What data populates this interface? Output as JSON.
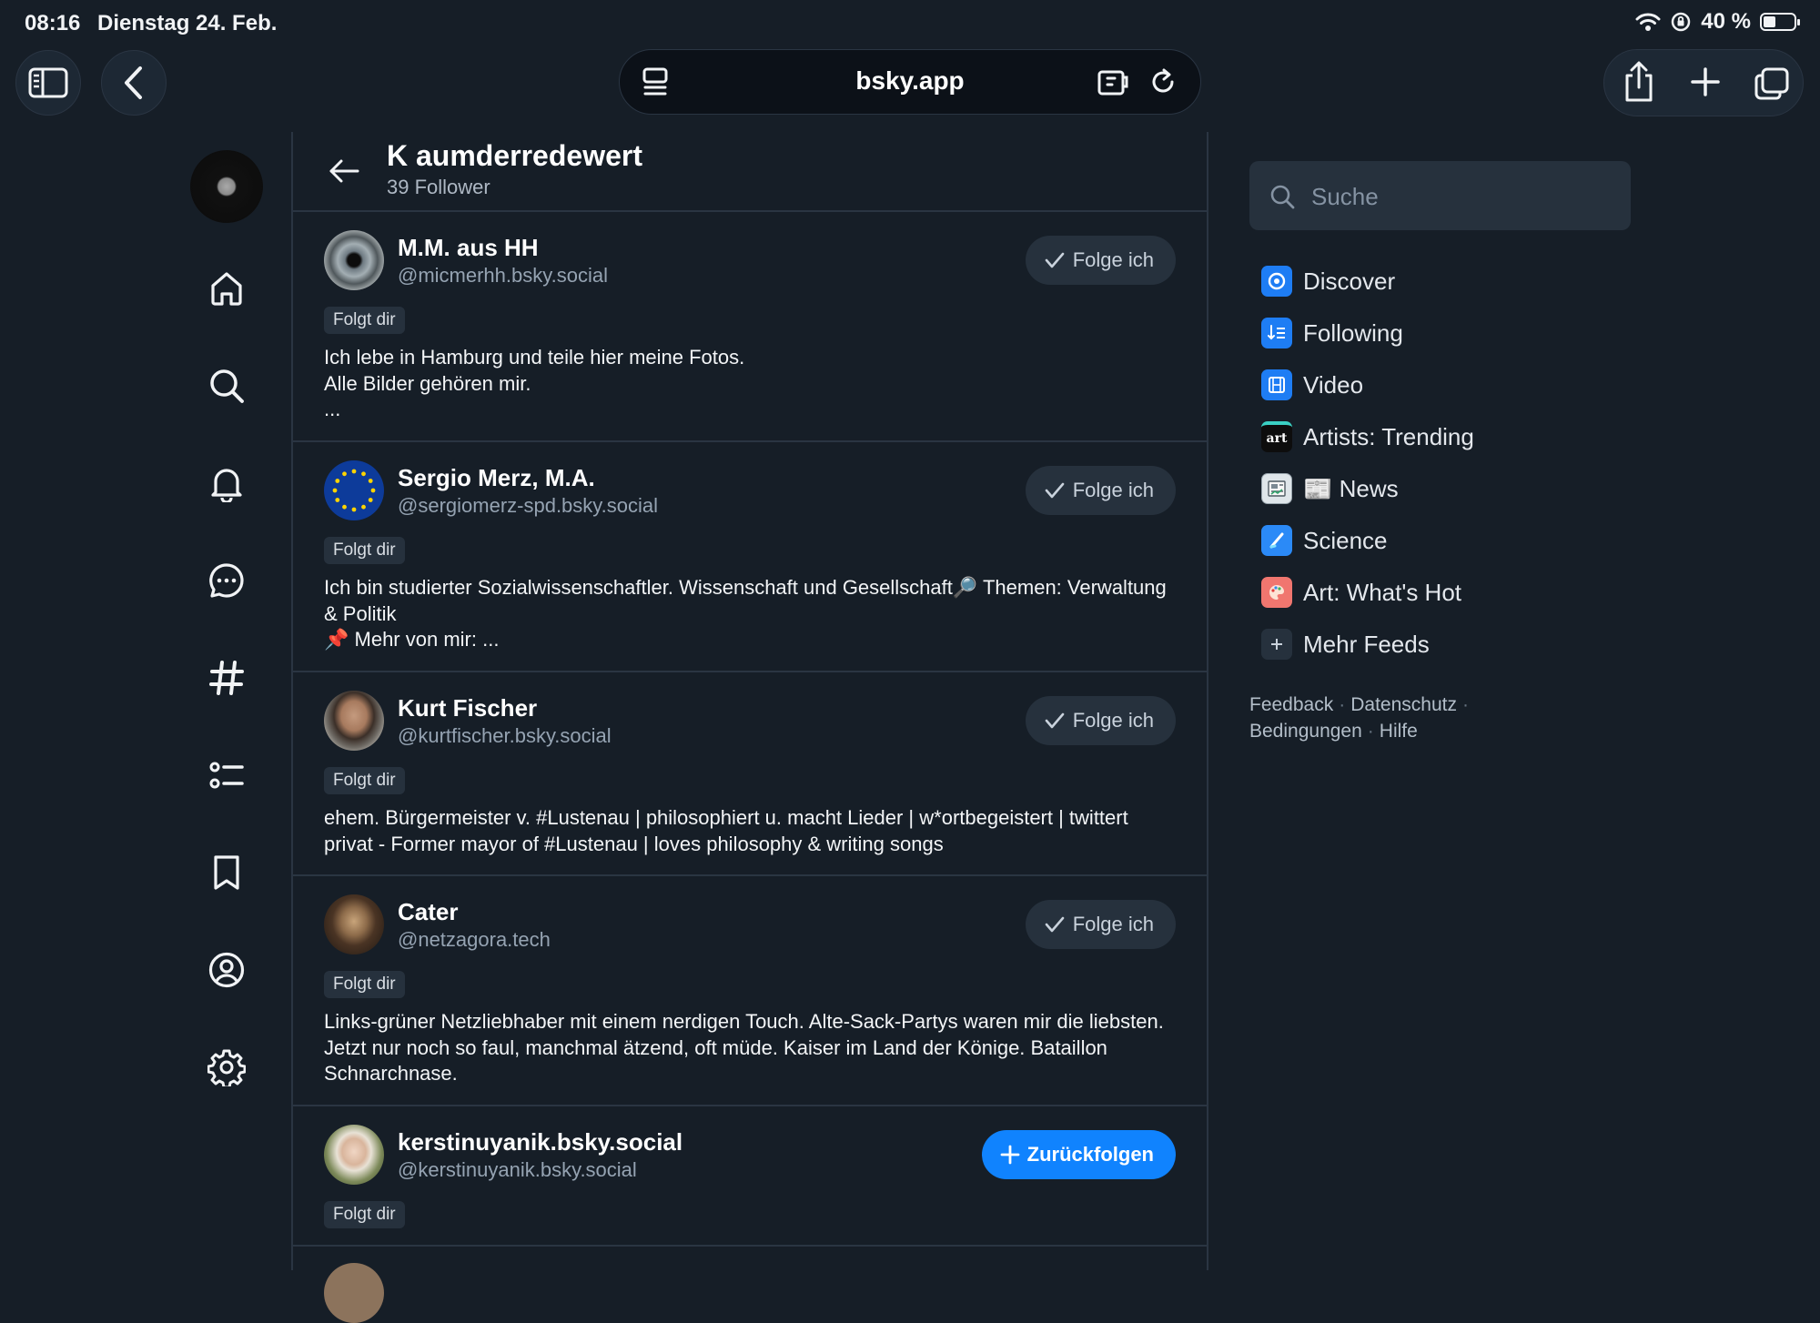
{
  "status_bar": {
    "time": "08:16",
    "date": "Dienstag 24. Feb.",
    "battery": "40 %",
    "battery_level": 0.4
  },
  "browser": {
    "url": "bsky.app"
  },
  "profile": {
    "title": "K aumderredewert",
    "subtitle": "39 Follower"
  },
  "followers": [
    {
      "name": "M.M. aus HH",
      "handle": "@micmerhh.bsky.social",
      "badge": "Folgt dir",
      "bio": "Ich lebe in Hamburg und teile hier meine Fotos.\nAlle Bilder gehören mir.\n...",
      "button": "Folge ich",
      "following": true
    },
    {
      "name": "Sergio Merz, M.A.",
      "handle": "@sergiomerz-spd.bsky.social",
      "badge": "Folgt dir",
      "bio": "Ich bin studierter Sozialwissenschaftler. Wissenschaft und Gesellschaft🔎 Themen: Verwaltung & Politik\n📌 Mehr von mir:  ...",
      "button": "Folge ich",
      "following": true
    },
    {
      "name": "Kurt Fischer",
      "handle": "@kurtfischer.bsky.social",
      "badge": "Folgt dir",
      "bio": "ehem. Bürgermeister v. #Lustenau | philosophiert u. macht Lieder | w*ortbegeistert | twittert privat - Former mayor of #Lustenau | loves philosophy & writing songs",
      "button": "Folge ich",
      "following": true
    },
    {
      "name": "Cater",
      "handle": "@netzagora.tech",
      "badge": "Folgt dir",
      "bio": "Links-grüner Netzliebhaber mit einem nerdigen Touch. Alte-Sack-Partys waren mir die liebsten. Jetzt nur noch so faul, manchmal ätzend, oft müde. Kaiser im Land der Könige. Bataillon Schnarchnase.",
      "button": "Folge ich",
      "following": true
    },
    {
      "name": "kerstinuyanik.bsky.social",
      "handle": "@kerstinuyanik.bsky.social",
      "badge": "Folgt dir",
      "bio": "",
      "button": "Zurückfolgen",
      "following": false
    }
  ],
  "search": {
    "placeholder": "Suche"
  },
  "feeds": [
    {
      "label": "Discover",
      "icon": "discover-icon"
    },
    {
      "label": "Following",
      "icon": "following-icon"
    },
    {
      "label": "Video",
      "icon": "video-icon"
    },
    {
      "label": "Artists: Trending",
      "icon": "art-icon",
      "icon_text": "art"
    },
    {
      "label": "📰 News",
      "icon": "news-icon"
    },
    {
      "label": "Science",
      "icon": "science-icon"
    },
    {
      "label": "Art: What's Hot",
      "icon": "palette-icon"
    },
    {
      "label": "Mehr Feeds",
      "icon": "plus-icon"
    }
  ],
  "footer": {
    "feedback": "Feedback",
    "privacy": "Datenschutz",
    "terms": "Bedingungen",
    "help": "Hilfe"
  },
  "colors": {
    "background": "#161e27",
    "accent": "#1083fe",
    "separator": "#2a3542"
  }
}
